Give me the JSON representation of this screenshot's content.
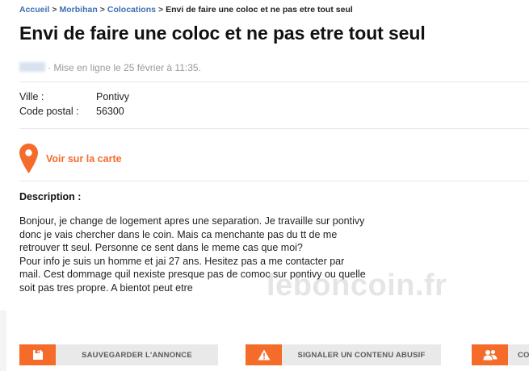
{
  "breadcrumb": {
    "items": [
      "Accueil",
      "Morbihan",
      "Colocations"
    ],
    "separator": ">",
    "current": "Envi de faire une coloc et ne pas etre tout seul"
  },
  "title": "Envi de faire une coloc et ne pas etre tout seul",
  "meta": {
    "posted": "· Mise en ligne le 25 février à 11:35."
  },
  "properties": [
    {
      "label": "Ville :",
      "value": "Pontivy"
    },
    {
      "label": "Code postal :",
      "value": "56300"
    }
  ],
  "map_link": {
    "label": "Voir sur la carte",
    "icon": "map-pin-icon"
  },
  "description": {
    "title": "Description :",
    "paragraphs": [
      "Bonjour, je change de logement apres une separation. Je travaille sur pontivy donc je vais chercher dans le coin. Mais ca menchante pas du tt de me retrouver tt seul. Personne ce sent dans le meme cas que moi?",
      "Pour info je suis un homme et jai 27 ans. Hesitez pas a me contacter par mail. Cest dommage quil nexiste presque pas de comoc sur pontivy ou quelle soit pas tres propre. A bientot peut etre"
    ]
  },
  "watermark": "leboncoin.fr",
  "actions": {
    "save": {
      "label": "SAUVEGARDER L'ANNONCE",
      "icon": "save-icon"
    },
    "report": {
      "label": "SIGNALER UN CONTENU ABUSIF",
      "icon": "warning-icon"
    },
    "share": {
      "label": "CO",
      "icon": "users-icon"
    }
  },
  "colors": {
    "accent": "#f56b2a",
    "link": "#3d6fb2",
    "button_bg": "#e9e9e9"
  }
}
